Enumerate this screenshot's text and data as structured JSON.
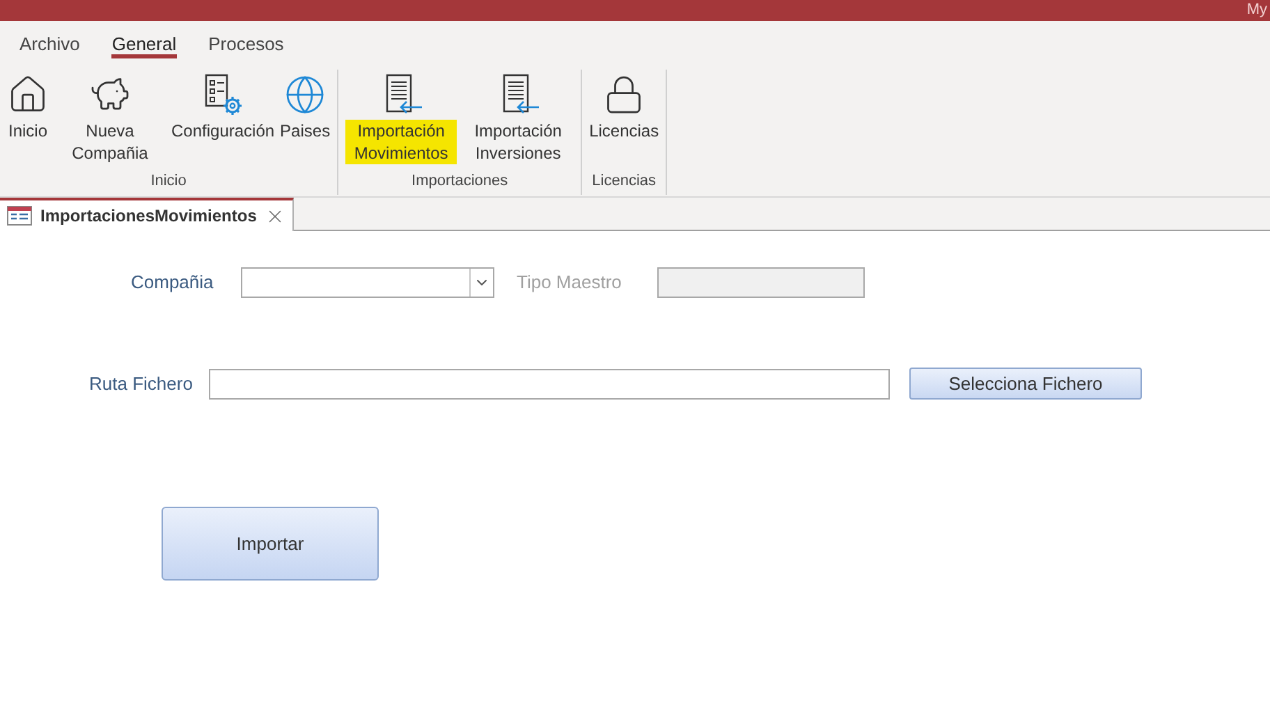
{
  "window": {
    "title": "My"
  },
  "menu_tabs": [
    {
      "label": "Archivo",
      "selected": false
    },
    {
      "label": "General",
      "selected": true
    },
    {
      "label": "Procesos",
      "selected": false
    }
  ],
  "ribbon_groups": [
    {
      "label": "Inicio",
      "buttons": [
        {
          "label": "Inicio",
          "highlighted": false
        },
        {
          "label": "Nueva Compañia",
          "highlighted": false
        },
        {
          "label": "Configuración",
          "highlighted": false
        },
        {
          "label": "Paises",
          "highlighted": false
        }
      ]
    },
    {
      "label": "Importaciones",
      "buttons": [
        {
          "label": "Importación Movimientos",
          "highlighted": true
        },
        {
          "label": "Importación Inversiones",
          "highlighted": false
        }
      ]
    },
    {
      "label": "Licencias",
      "buttons": [
        {
          "label": "Licencias",
          "highlighted": false
        }
      ]
    }
  ],
  "document_tab": {
    "title": "ImportacionesMovimientos"
  },
  "form": {
    "company": {
      "label": "Compañia"
    },
    "master_type": {
      "label": "Tipo Maestro",
      "disabled": true
    },
    "file_path": {
      "label": "Ruta Fichero"
    },
    "select_file_button": "Selecciona Fichero",
    "import_button": "Importar"
  }
}
